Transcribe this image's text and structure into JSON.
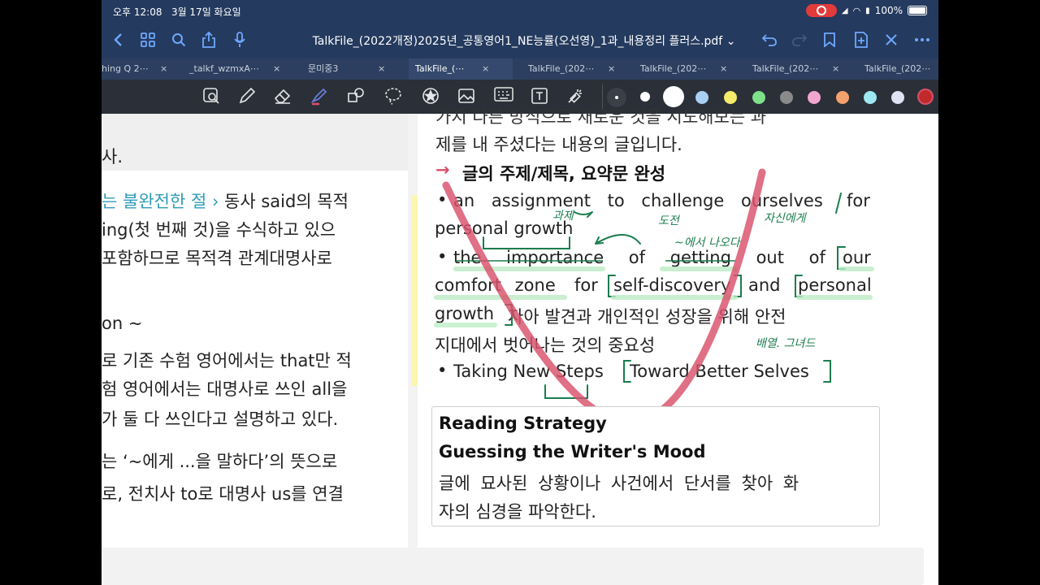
{
  "status_bar": {
    "time": "오후 12:08",
    "date": "3월 17일 화요일",
    "battery": "100%"
  },
  "title_bar": {
    "title": "TalkFile_(2022개정)2025년_공통영어1_NE능률(오선영)_1과_내용정리 플러스.pdf ⌄"
  },
  "tabs": [
    {
      "label": "hing Q 2⋯"
    },
    {
      "label": "_talkf_wzmxA⋯"
    },
    {
      "label": "문미중3"
    },
    {
      "label": "TalkFile_(⋯"
    },
    {
      "label": "TalkFile_(202⋯"
    },
    {
      "label": "TalkFile_(202⋯"
    },
    {
      "label": "TalkFile_(202⋯"
    },
    {
      "label": "TalkFile_(202⋯"
    }
  ],
  "tab_close": "×",
  "colors": {
    "title_bar_bg": "#243a5e",
    "accent_blue": "#6fa8ff",
    "pen_red": "#d9506a",
    "handwriting_green": "#1b7d4e",
    "swatches": [
      "#ffffff",
      "#ffffff",
      "#ffffff",
      "#a8d0f5",
      "#f4ec6a",
      "#7fe08a",
      "#8a8a8a",
      "#f2a6cf",
      "#f5a06e",
      "#9ee8f2",
      "#e0e2f5",
      "#c02a2a"
    ]
  },
  "left_column": {
    "lines": [
      {
        "text": "사."
      },
      {
        "cyan": "는 불완전한 절 ›",
        "text": " 동사 said의 목적"
      },
      {
        "text": "ing(첫 번째 것)을 수식하고 있으"
      },
      {
        "text": "포함하므로 목적격 관계대명사로"
      },
      {
        "text": "on ~"
      },
      {
        "text": "로 기존 수험 영어에서는 that만 적"
      },
      {
        "text": "험 영어에서는 대명사로 쓰인 all을"
      },
      {
        "text": "가 둘 다 쓰인다고 설명하고 있다."
      },
      {
        "text": "는 ‘~에게 ...을 말하다’의 뜻으로"
      },
      {
        "text": "로, 전치사 to로 대명사 us를 연결"
      }
    ]
  },
  "right_column": {
    "top_cut": "가지 다른 방식으로 새로운 것을 시도해보는 과",
    "line2": "제를 내 주셨다는 내용의 글입니다.",
    "section_marker": "→",
    "section_title": "글의 주제/제목, 요약문 완성",
    "bullet": "•",
    "item1_a": "an assignment to challenge ourselves",
    "item1_b": "for",
    "item1_c": "personal growth",
    "item2_a": "the importance of getting out of",
    "item2_b": "our",
    "item2_c": "comfort zone",
    "item2_d": "for",
    "item2_e": "self-discovery",
    "item2_f": "and",
    "item2_g": "personal",
    "item2_h": "growth",
    "item2_i": "자아 발견과 개인적인 성장을 위해 안전",
    "item2_j": "지대에서 벗어나는 것의 중요성",
    "item3_a": "Taking New Steps",
    "item3_b": "Toward Better Selves"
  },
  "handwritten": {
    "n1": "과제",
    "n2": "도전",
    "n3": "자신에게",
    "n4": "~에서 나오다",
    "n5": "배열. 그녀드"
  },
  "strategy_box": {
    "title1": "Reading Strategy",
    "title2": "Guessing the Writer's Mood",
    "body1": "글에 묘사된 상황이나 사건에서 단서를 찾아 화",
    "body2": "자의 심경을 파악한다."
  }
}
